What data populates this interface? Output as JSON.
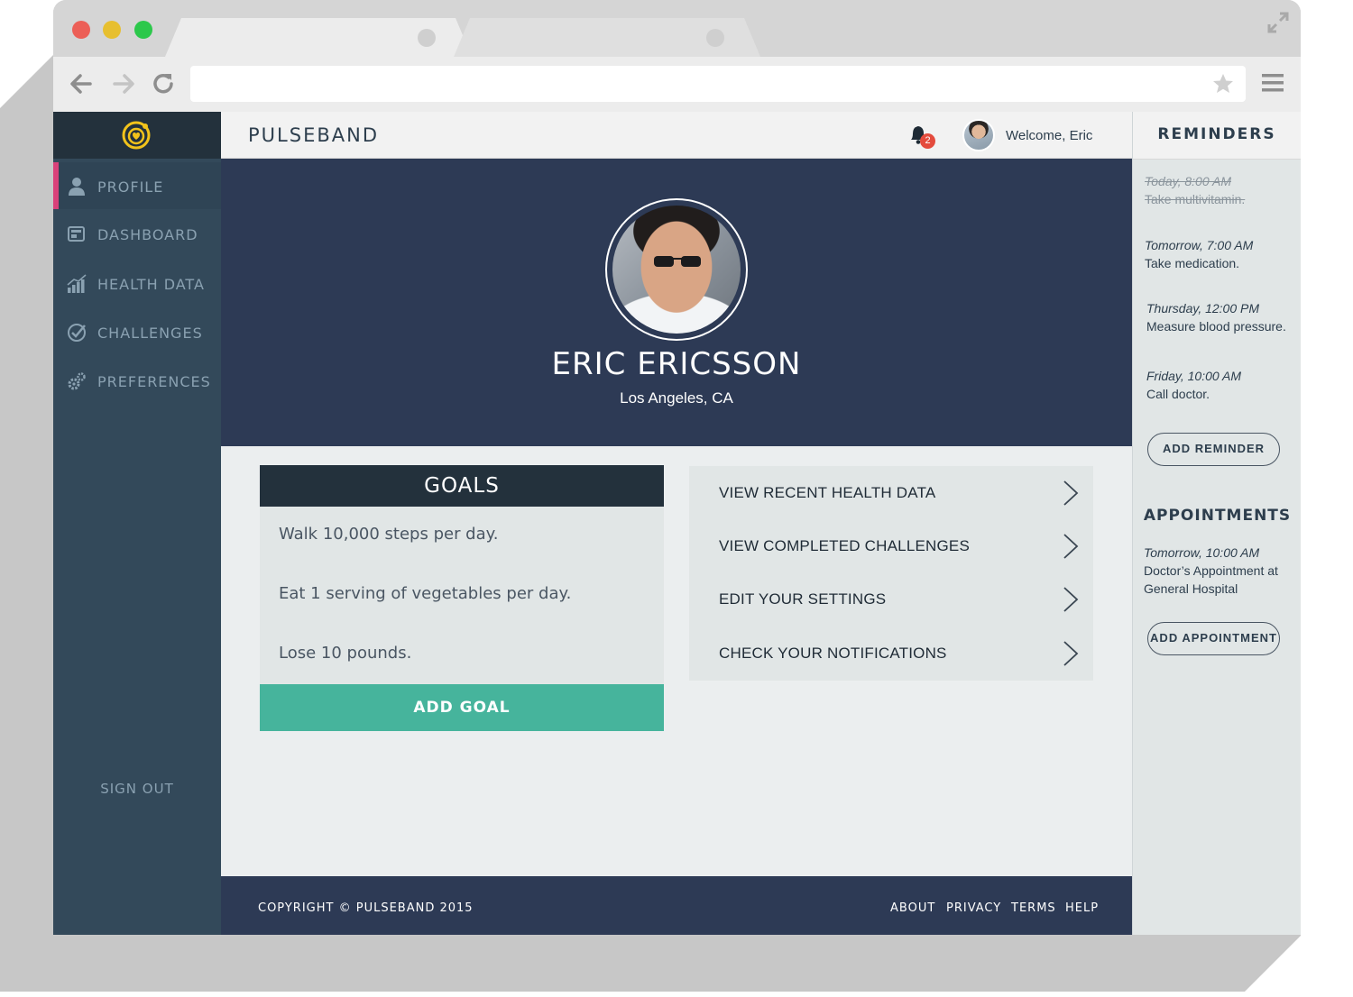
{
  "colors": {
    "sidebar": "#33495a",
    "sidebar_dark": "#23313c",
    "active_marker": "#d9417a",
    "hero": "#2d3a55",
    "accent": "#46b49c",
    "badge": "#e44b3d",
    "logo": "#f2c31b"
  },
  "browser": {
    "traffic_lights": [
      "red",
      "yellow",
      "green"
    ],
    "icons": [
      "back-arrow-icon",
      "forward-arrow-icon",
      "reload-icon",
      "star-icon",
      "hamburger-menu-icon",
      "expand-icon"
    ]
  },
  "app": {
    "title": "PULSEBAND",
    "welcome": "Welcome, Eric",
    "notification_count": "2"
  },
  "sidebar": {
    "items": [
      {
        "label": "PROFILE",
        "icon": "user-icon",
        "active": true
      },
      {
        "label": "DASHBOARD",
        "icon": "dashboard-icon",
        "active": false
      },
      {
        "label": "HEALTH DATA",
        "icon": "bar-chart-icon",
        "active": false
      },
      {
        "label": "CHALLENGES",
        "icon": "check-circle-icon",
        "active": false
      },
      {
        "label": "PREFERENCES",
        "icon": "gears-icon",
        "active": false
      }
    ],
    "sign_out": "SIGN OUT"
  },
  "profile": {
    "name": "ERIC ERICSSON",
    "location": "Los Angeles, CA"
  },
  "goals": {
    "title": "GOALS",
    "items": [
      "Walk 10,000 steps per day.",
      "Eat 1 serving of vegetables per day.",
      "Lose 10 pounds."
    ],
    "add_label": "ADD GOAL"
  },
  "links": [
    "VIEW RECENT HEALTH DATA",
    "VIEW COMPLETED CHALLENGES",
    "EDIT YOUR SETTINGS",
    "CHECK YOUR NOTIFICATIONS"
  ],
  "footer": {
    "copyright": "COPYRIGHT © PULSEBAND 2015",
    "links": [
      "ABOUT",
      "PRIVACY",
      "TERMS",
      "HELP"
    ]
  },
  "reminders": {
    "title": "REMINDERS",
    "items": [
      {
        "when": "Today, 8:00 AM",
        "what": "Take multivitamin.",
        "done": true
      },
      {
        "when": "Tomorrow, 7:00 AM",
        "what": "Take medication.",
        "done": false
      },
      {
        "when": "Thursday, 12:00 PM",
        "what": "Measure blood pressure.",
        "done": false
      },
      {
        "when": "Friday, 10:00 AM",
        "what": "Call doctor.",
        "done": false
      }
    ],
    "add_label": "ADD REMINDER"
  },
  "appointments": {
    "title": "APPOINTMENTS",
    "items": [
      {
        "when": "Tomorrow, 10:00 AM",
        "what_line1": "Doctor’s Appointment at",
        "what_line2": "General Hospital"
      }
    ],
    "add_label": "ADD APPOINTMENT"
  }
}
